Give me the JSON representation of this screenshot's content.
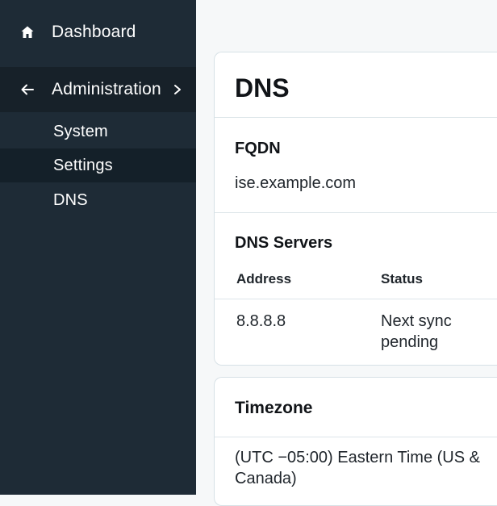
{
  "sidebar": {
    "dashboard": {
      "label": "Dashboard",
      "icon": "home-icon"
    },
    "administration": {
      "label": "Administration",
      "back_icon": "arrow-left-icon",
      "chevron_icon": "chevron-right-icon"
    },
    "sub_items": [
      {
        "label": "System",
        "selected": false
      },
      {
        "label": "Settings",
        "selected": true
      },
      {
        "label": "DNS",
        "selected": false
      }
    ]
  },
  "dns_card": {
    "title": "DNS",
    "fqdn": {
      "heading": "FQDN",
      "value": "ise.example.com"
    },
    "servers": {
      "heading": "DNS Servers",
      "columns": [
        "Address",
        "Status"
      ],
      "rows": [
        {
          "address": "8.8.8.8",
          "status": "Next sync pending"
        }
      ]
    }
  },
  "timezone_card": {
    "heading": "Timezone",
    "value": "(UTC −05:00) Eastern Time (US & Canada)"
  },
  "colors": {
    "sidebar_bg": "#1e2b36",
    "sidebar_active_bg": "#172129",
    "main_bg": "#f6f8f9",
    "card_border": "#d7e1e6"
  }
}
